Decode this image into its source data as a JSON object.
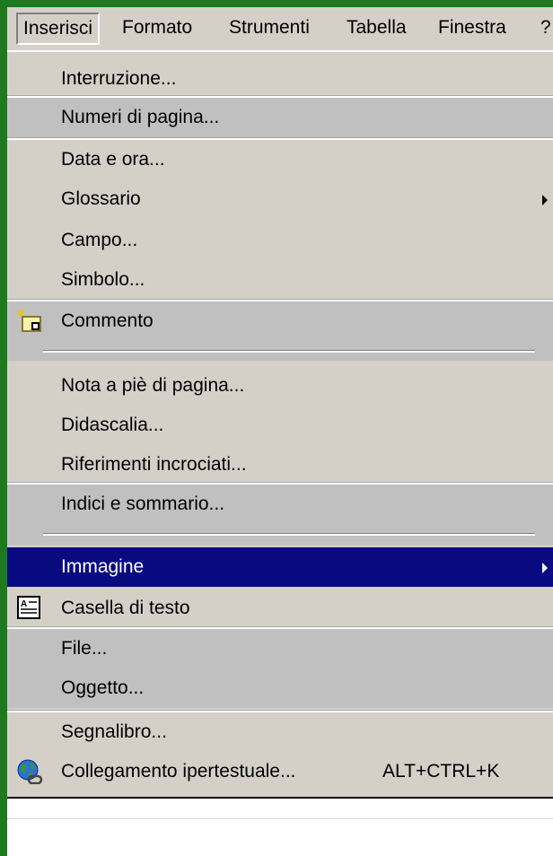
{
  "menubar": {
    "items": [
      "Inserisci",
      "Formato",
      "Strumenti",
      "Tabella",
      "Finestra",
      "?"
    ]
  },
  "menu": {
    "items": [
      {
        "label": "Interruzione...",
        "shortcut": "",
        "submenu": false,
        "icon": ""
      },
      {
        "label": "Numeri di pagina...",
        "shortcut": "",
        "submenu": false,
        "icon": ""
      },
      {
        "label": "Data e ora...",
        "shortcut": "",
        "submenu": false,
        "icon": ""
      },
      {
        "label": "Glossario",
        "shortcut": "",
        "submenu": true,
        "icon": ""
      },
      {
        "label": "Campo...",
        "shortcut": "",
        "submenu": false,
        "icon": ""
      },
      {
        "label": "Simbolo...",
        "shortcut": "",
        "submenu": false,
        "icon": ""
      },
      {
        "label": "Commento",
        "shortcut": "",
        "submenu": false,
        "icon": "comment-icon"
      },
      {
        "label": "Nota a piè di pagina...",
        "shortcut": "",
        "submenu": false,
        "icon": ""
      },
      {
        "label": "Didascalia...",
        "shortcut": "",
        "submenu": false,
        "icon": ""
      },
      {
        "label": "Riferimenti incrociati...",
        "shortcut": "",
        "submenu": false,
        "icon": ""
      },
      {
        "label": "Indici e sommario...",
        "shortcut": "",
        "submenu": false,
        "icon": ""
      },
      {
        "label": "Immagine",
        "shortcut": "",
        "submenu": true,
        "icon": ""
      },
      {
        "label": "Casella di testo",
        "shortcut": "",
        "submenu": false,
        "icon": "text-box-icon"
      },
      {
        "label": "File...",
        "shortcut": "",
        "submenu": false,
        "icon": ""
      },
      {
        "label": "Oggetto...",
        "shortcut": "",
        "submenu": false,
        "icon": ""
      },
      {
        "label": "Segnalibro...",
        "shortcut": "",
        "submenu": false,
        "icon": ""
      },
      {
        "label": "Collegamento ipertestuale...",
        "shortcut": "ALT+CTRL+K",
        "submenu": false,
        "icon": "hyperlink-globe-icon"
      }
    ]
  },
  "colors": {
    "menu_bg": "#d4d0c8",
    "highlight_bg": "#0a0a80",
    "frame": "#1f7a1f"
  }
}
